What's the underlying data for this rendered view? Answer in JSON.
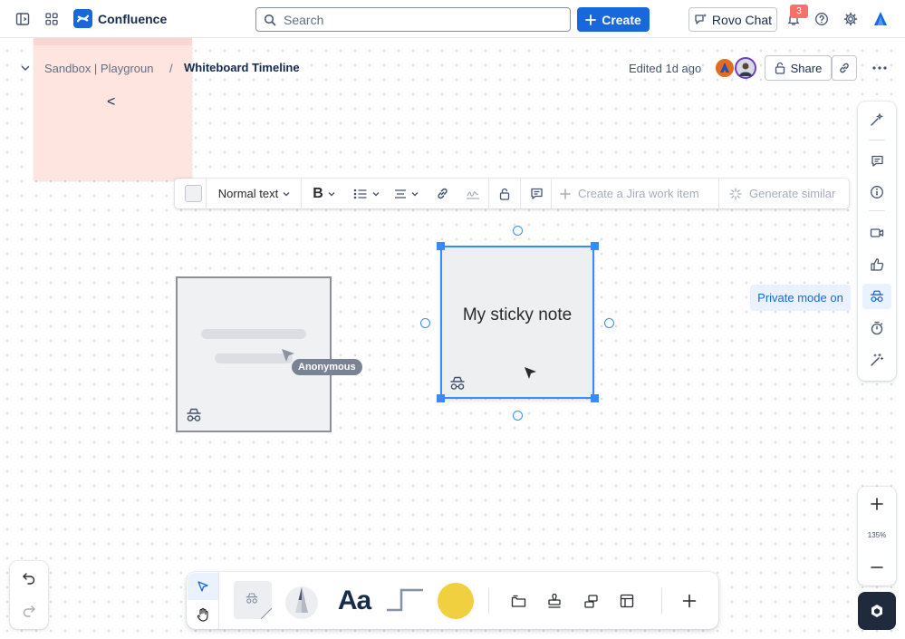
{
  "header": {
    "app_name": "Confluence",
    "search_placeholder": "Search",
    "create_label": "Create",
    "rovo_label": "Rovo Chat",
    "notification_count": "3",
    "colors": {
      "brand": "#1868db",
      "badge": "#f87168"
    }
  },
  "breadcrumb": {
    "space": "Sandbox | Playgroun",
    "separator": "/",
    "title": "Whiteboard Timeline",
    "edited": "Edited 1d ago",
    "share_label": "Share"
  },
  "canvas": {
    "pink_note_glyph": "<",
    "anonymous_label": "Anonymous",
    "sticky_text": "My sticky note",
    "private_mode_label": "Private mode on",
    "zoom_level": "135%"
  },
  "text_toolbar": {
    "text_style": "Normal text",
    "create_jira": "Create a Jira work item",
    "generate_similar": "Generate similar"
  },
  "right_rail": {
    "items": [
      "ai-sparkle-icon",
      "comment-icon",
      "info-icon",
      "video-icon",
      "like-icon",
      "private-mode-icon",
      "timer-icon",
      "magic-wand-icon"
    ]
  },
  "bottom_toolbar": {
    "text_tool_label": "Aa",
    "sticky_color": "#f0d03e",
    "tools": [
      "select-icon",
      "hand-icon",
      "sticky-note-icon",
      "pen-icon",
      "text-icon",
      "connector-icon",
      "color-swatch",
      "frame-icon",
      "stamp-icon",
      "shapes-icon",
      "template-icon",
      "add-icon"
    ]
  }
}
